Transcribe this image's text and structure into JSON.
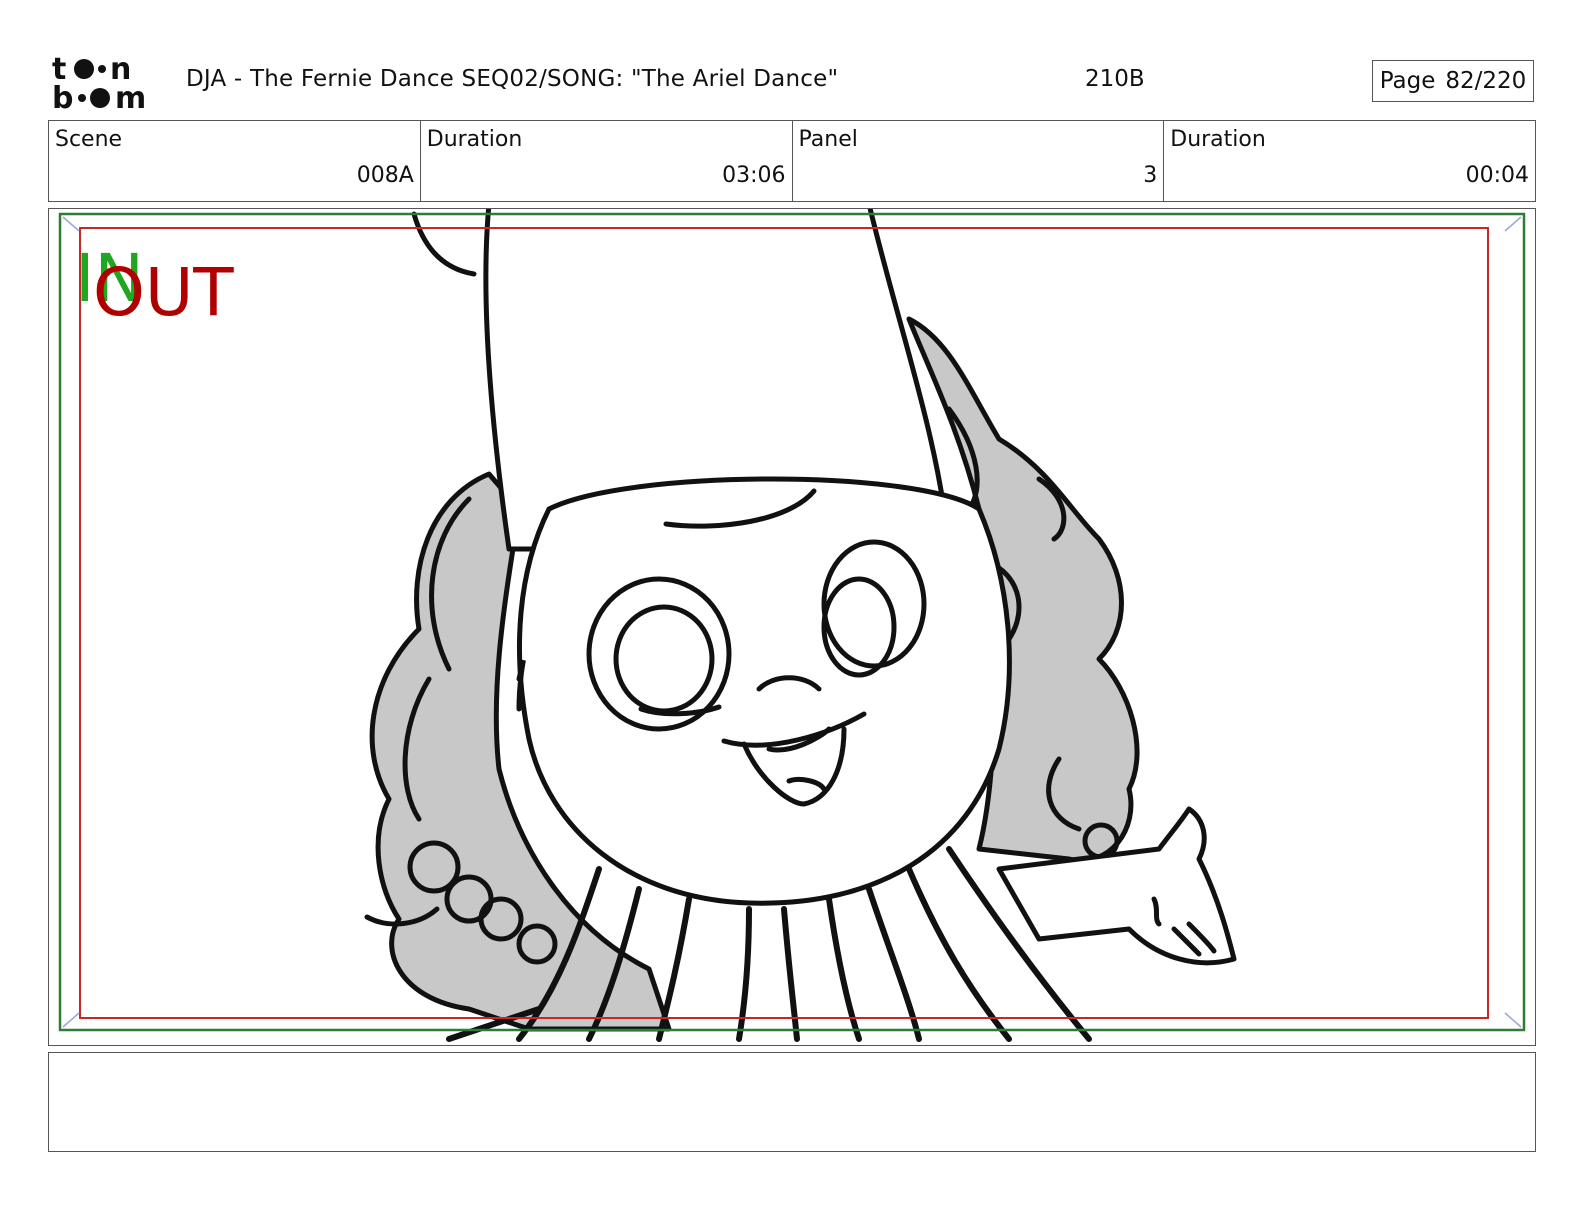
{
  "header": {
    "logo_text": "toon boom",
    "title": "DJA - The Fernie Dance  SEQ02/SONG: \"The Ariel Dance\"",
    "code": "210B",
    "page_label": "Page",
    "page_value": "82/220"
  },
  "info": {
    "scene_label": "Scene",
    "scene_value": "008A",
    "scene_duration_label": "Duration",
    "scene_duration_value": "03:06",
    "panel_label": "Panel",
    "panel_value": "3",
    "panel_duration_label": "Duration",
    "panel_duration_value": "00:04"
  },
  "panel": {
    "in_marker": "IN",
    "out_marker": "OUT",
    "safe_frame_color": "#2e7d32",
    "action_frame_color": "#c62828",
    "in_color": "#1fa81f",
    "out_color": "#b00000",
    "hair_color": "#c8c8c8",
    "line_color": "#111111"
  },
  "notes": {
    "text": ""
  }
}
